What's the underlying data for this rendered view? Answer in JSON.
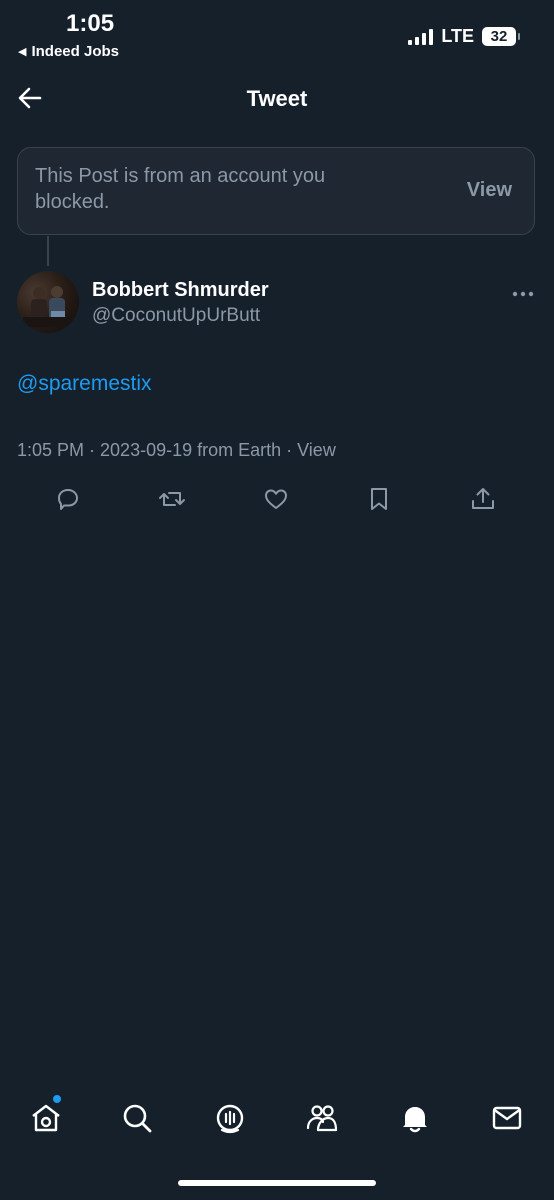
{
  "status": {
    "time": "1:05",
    "back_app": "Indeed Jobs",
    "network": "LTE",
    "battery": "32"
  },
  "header": {
    "title": "Tweet"
  },
  "blocked_notice": {
    "text": "This Post is from an account you blocked.",
    "view_label": "View"
  },
  "tweet": {
    "display_name": "Bobbert Shmurder",
    "handle": "@CoconutUpUrButt",
    "text": "@sparemestix",
    "meta": "1:05 PM · 2023-09-19 from Earth · View"
  },
  "icons": {
    "actions": [
      "reply-icon",
      "retweet-icon",
      "like-icon",
      "bookmark-icon",
      "share-icon"
    ],
    "tabs": [
      "home-icon",
      "search-icon",
      "spaces-icon",
      "communities-icon",
      "notifications-icon",
      "messages-icon"
    ]
  },
  "colors": {
    "background": "#15202b",
    "accent": "#1d9bf0",
    "secondary_text": "#8b98a5",
    "card": "#1e2732",
    "border": "#38444d"
  }
}
